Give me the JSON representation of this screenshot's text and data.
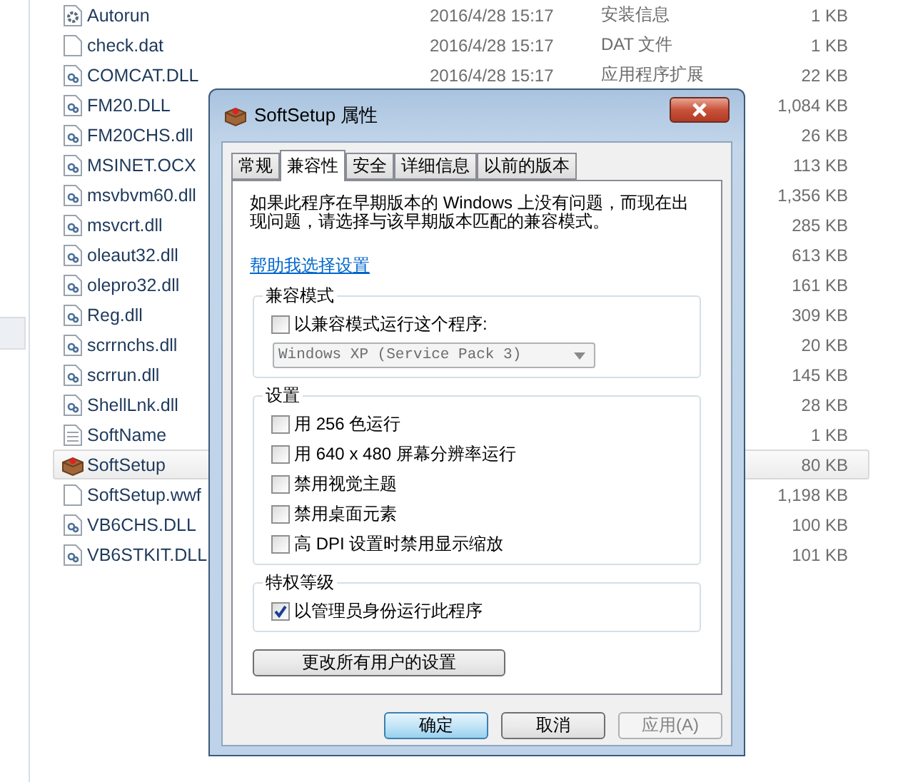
{
  "files": [
    {
      "kind": "setup",
      "name": "Autorun",
      "date": "2016/4/28 15:17",
      "type": "安装信息",
      "size": "1 KB",
      "selected": false
    },
    {
      "kind": "blank",
      "name": "check.dat",
      "date": "2016/4/28 15:17",
      "type": "DAT 文件",
      "size": "1 KB",
      "selected": false
    },
    {
      "kind": "dll",
      "name": "COMCAT.DLL",
      "date": "2016/4/28 15:17",
      "type": "应用程序扩展",
      "size": "22 KB",
      "selected": false
    },
    {
      "kind": "dll",
      "name": "FM20.DLL",
      "size": "1,084 KB",
      "selected": false
    },
    {
      "kind": "dll",
      "name": "FM20CHS.dll",
      "size": "26 KB",
      "selected": false
    },
    {
      "kind": "dll",
      "name": "MSINET.OCX",
      "size": "113 KB",
      "selected": false
    },
    {
      "kind": "dll",
      "name": "msvbvm60.dll",
      "size": "1,356 KB",
      "selected": false
    },
    {
      "kind": "dll",
      "name": "msvcrt.dll",
      "size": "285 KB",
      "selected": false
    },
    {
      "kind": "dll",
      "name": "oleaut32.dll",
      "size": "613 KB",
      "selected": false
    },
    {
      "kind": "dll",
      "name": "olepro32.dll",
      "size": "161 KB",
      "selected": false
    },
    {
      "kind": "dll",
      "name": "Reg.dll",
      "size": "309 KB",
      "selected": false
    },
    {
      "kind": "dll",
      "name": "scrrnchs.dll",
      "size": "20 KB",
      "selected": false
    },
    {
      "kind": "dll",
      "name": "scrrun.dll",
      "size": "145 KB",
      "selected": false
    },
    {
      "kind": "dll",
      "name": "ShellLnk.dll",
      "size": "28 KB",
      "selected": false
    },
    {
      "kind": "text",
      "name": "SoftName",
      "size": "1 KB",
      "selected": false
    },
    {
      "kind": "package",
      "name": "SoftSetup",
      "size": "80 KB",
      "selected": true
    },
    {
      "kind": "blank",
      "name": "SoftSetup.wwf",
      "size": "1,198 KB",
      "selected": false
    },
    {
      "kind": "dll",
      "name": "VB6CHS.DLL",
      "size": "100 KB",
      "selected": false
    },
    {
      "kind": "dll",
      "name": "VB6STKIT.DLL",
      "size": "101 KB",
      "selected": false
    }
  ],
  "dialog": {
    "title": "SoftSetup 属性",
    "tabs": [
      {
        "label": "常规",
        "selected": false
      },
      {
        "label": "兼容性",
        "selected": true
      },
      {
        "label": "安全",
        "selected": false
      },
      {
        "label": "详细信息",
        "selected": false
      },
      {
        "label": "以前的版本",
        "selected": false
      }
    ],
    "description": "如果此程序在早期版本的 Windows 上没有问题，而现在出现问题，请选择与该早期版本匹配的兼容模式。",
    "help_link": "帮助我选择设置",
    "compat_group": {
      "title": "兼容模式",
      "checkbox": {
        "label": "以兼容模式运行这个程序:",
        "checked": false
      },
      "dropdown": {
        "value": "Windows XP (Service Pack 3)",
        "disabled": true
      }
    },
    "settings_group": {
      "title": "设置",
      "options": [
        {
          "label": "用 256 色运行",
          "checked": false
        },
        {
          "label": "用 640 x 480 屏幕分辨率运行",
          "checked": false
        },
        {
          "label": "禁用视觉主题",
          "checked": false
        },
        {
          "label": "禁用桌面元素",
          "checked": false
        },
        {
          "label": "高 DPI 设置时禁用显示缩放",
          "checked": false
        }
      ]
    },
    "privilege_group": {
      "title": "特权等级",
      "checkbox": {
        "label": "以管理员身份运行此程序",
        "checked": true
      }
    },
    "all_users_button": "更改所有用户的设置",
    "buttons": [
      {
        "label": "确定",
        "kind": "default",
        "disabled": false
      },
      {
        "label": "取消",
        "kind": "normal",
        "disabled": false
      },
      {
        "label": "应用(A)",
        "kind": "normal",
        "disabled": true
      }
    ]
  }
}
